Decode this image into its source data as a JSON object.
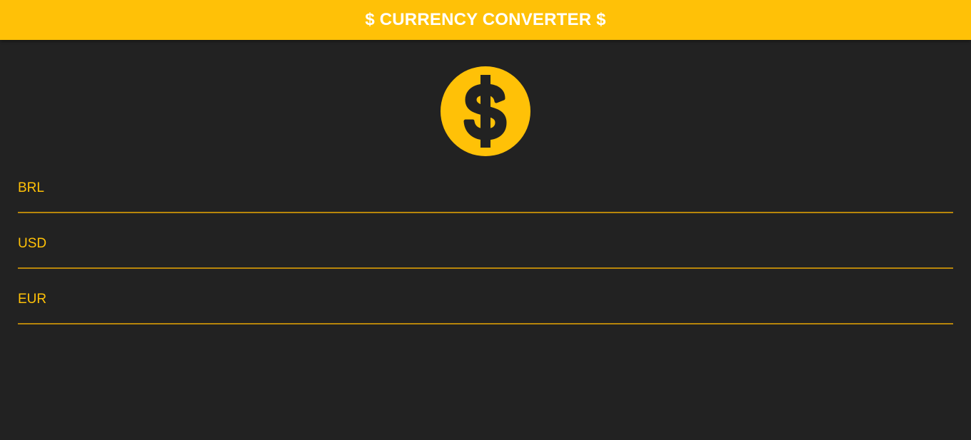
{
  "app_bar": {
    "title": "$ CURRENCY CONVERTER $",
    "background_color": "#FFC107",
    "title_color": "#FFFFFF"
  },
  "logo": {
    "icon": "monetization-on-icon",
    "color": "#FFC107"
  },
  "fields": [
    {
      "label": "BRL",
      "value": ""
    },
    {
      "label": "USD",
      "value": ""
    },
    {
      "label": "EUR",
      "value": ""
    }
  ],
  "colors": {
    "background": "#222222",
    "accent": "#FFC107",
    "underline": "#B8860B"
  }
}
